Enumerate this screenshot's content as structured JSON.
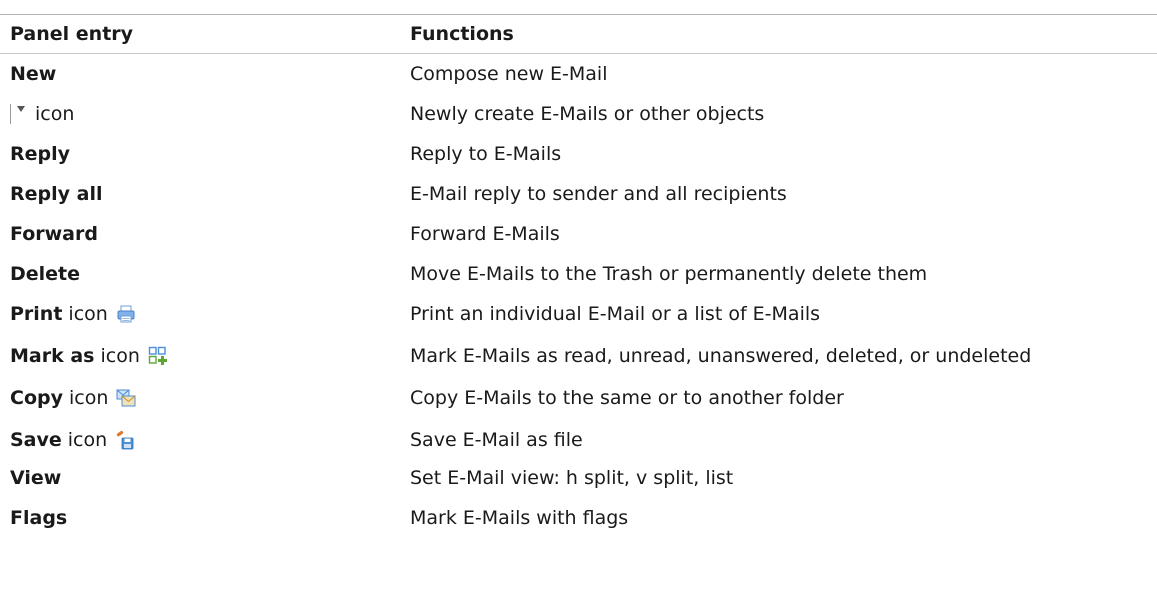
{
  "table": {
    "headers": {
      "entry": "Panel entry",
      "functions": "Functions"
    },
    "rows": [
      {
        "entry": "New",
        "suffix": "",
        "icon": "",
        "function": "Compose new E-Mail"
      },
      {
        "entry": "",
        "suffix": "icon",
        "icon": "dropdown-caret-icon",
        "function": "Newly create E-Mails or other objects"
      },
      {
        "entry": "Reply",
        "suffix": "",
        "icon": "",
        "function": "Reply to E-Mails"
      },
      {
        "entry": "Reply all",
        "suffix": "",
        "icon": "",
        "function": "E-Mail reply to sender and all recipients"
      },
      {
        "entry": "Forward",
        "suffix": "",
        "icon": "",
        "function": "Forward E-Mails"
      },
      {
        "entry": "Delete",
        "suffix": "",
        "icon": "",
        "function": "Move E-Mails to the Trash or permanently delete them"
      },
      {
        "entry": "Print",
        "suffix": "icon",
        "icon": "printer-icon",
        "function": "Print an individual E-Mail or a list of E-Mails"
      },
      {
        "entry": "Mark as",
        "suffix": "icon",
        "icon": "mark-as-icon",
        "function": "Mark E-Mails as read, unread, unanswered, deleted, or undeleted"
      },
      {
        "entry": "Copy",
        "suffix": "icon",
        "icon": "copy-envelopes-icon",
        "function": "Copy E-Mails to the same or to another folder"
      },
      {
        "entry": "Save",
        "suffix": "icon",
        "icon": "save-icon",
        "function": "Save E-Mail as file"
      },
      {
        "entry": "View",
        "suffix": "",
        "icon": "",
        "function": "Set E-Mail view: h split, v split, list"
      },
      {
        "entry": "Flags",
        "suffix": "",
        "icon": "",
        "function": "Mark E-Mails with flags"
      }
    ]
  },
  "colors": {
    "text": "#1a1a1a",
    "rule": "#b5b5b5",
    "icon_blue": "#4a8fd8",
    "icon_green": "#5aa832",
    "icon_orange": "#e07a2a"
  }
}
